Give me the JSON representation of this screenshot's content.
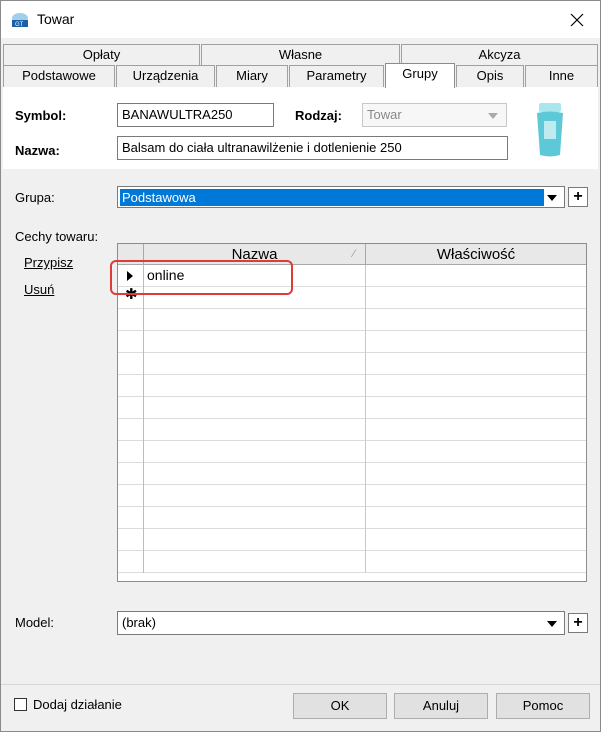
{
  "window": {
    "title": "Towar"
  },
  "tabs_top": [
    "Opłaty",
    "Własne",
    "Akcyza"
  ],
  "tabs_bottom": [
    "Podstawowe",
    "Urządzenia",
    "Miary",
    "Parametry",
    "Grupy",
    "Opis",
    "Inne"
  ],
  "active_tab": "Grupy",
  "form": {
    "symbol_label": "Symbol:",
    "symbol_value": "BANAWULTRA250",
    "rodzaj_label": "Rodzaj:",
    "rodzaj_value": "Towar",
    "nazwa_label": "Nazwa:",
    "nazwa_value": "Balsam do ciała ultranawilżenie i dotlenienie 250",
    "grupa_label": "Grupa:",
    "grupa_value": "Podstawowa",
    "grupa_plus": "+",
    "cechy_label": "Cechy towaru:",
    "przypisz_link": "Przypisz",
    "usun_link": "Usuń",
    "model_label": "Model:",
    "model_value": "(brak)",
    "model_plus": "+"
  },
  "grid": {
    "columns": [
      "Nazwa",
      "Właściwość"
    ],
    "sort_indicator": "⁄",
    "rows": [
      {
        "indicator": "▶",
        "nazwa": "online",
        "wlasciwosc": ""
      },
      {
        "indicator": "✱",
        "nazwa": "",
        "wlasciwosc": ""
      }
    ]
  },
  "footer": {
    "dodaj_label": "Dodaj działanie",
    "ok": "OK",
    "anuluj": "Anuluj",
    "pomoc": "Pomoc"
  },
  "colors": {
    "selection": "#0078d7",
    "highlight_border": "#e03a3a",
    "product_image": "#5cc8d8"
  },
  "icons": [
    "app-icon",
    "close-icon",
    "dropdown-arrow-icon",
    "row-pointer-icon",
    "new-row-icon",
    "product-image"
  ]
}
